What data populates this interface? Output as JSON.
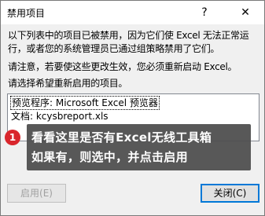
{
  "dialog": {
    "title": "禁用项目",
    "help_label": "?",
    "close_label": "✕",
    "description": "以下列表中的项目已被禁用，因为它们使 Excel 无法正常运行，或者您的系统管理员已通过组策略禁用了它们。",
    "restart_note": "请注意，若要使这些更改生效，您必须重新启动 Excel。",
    "select_prompt": "请选择希望重新启用的项目。",
    "items": [
      "预览程序: Microsoft Excel 预览器",
      "文档: kcysbreport.xls"
    ],
    "enable_button": "启用(E)",
    "close_button": "关闭(C)"
  },
  "annotation": {
    "badge": "1",
    "line1": "看看这里是否有Excel无线工具箱",
    "line2": "如果有，则选中，并点击启用"
  },
  "colors": {
    "badge": "#d9262c",
    "tooltip_bg": "#505050",
    "focus_border": "#0078d7"
  }
}
